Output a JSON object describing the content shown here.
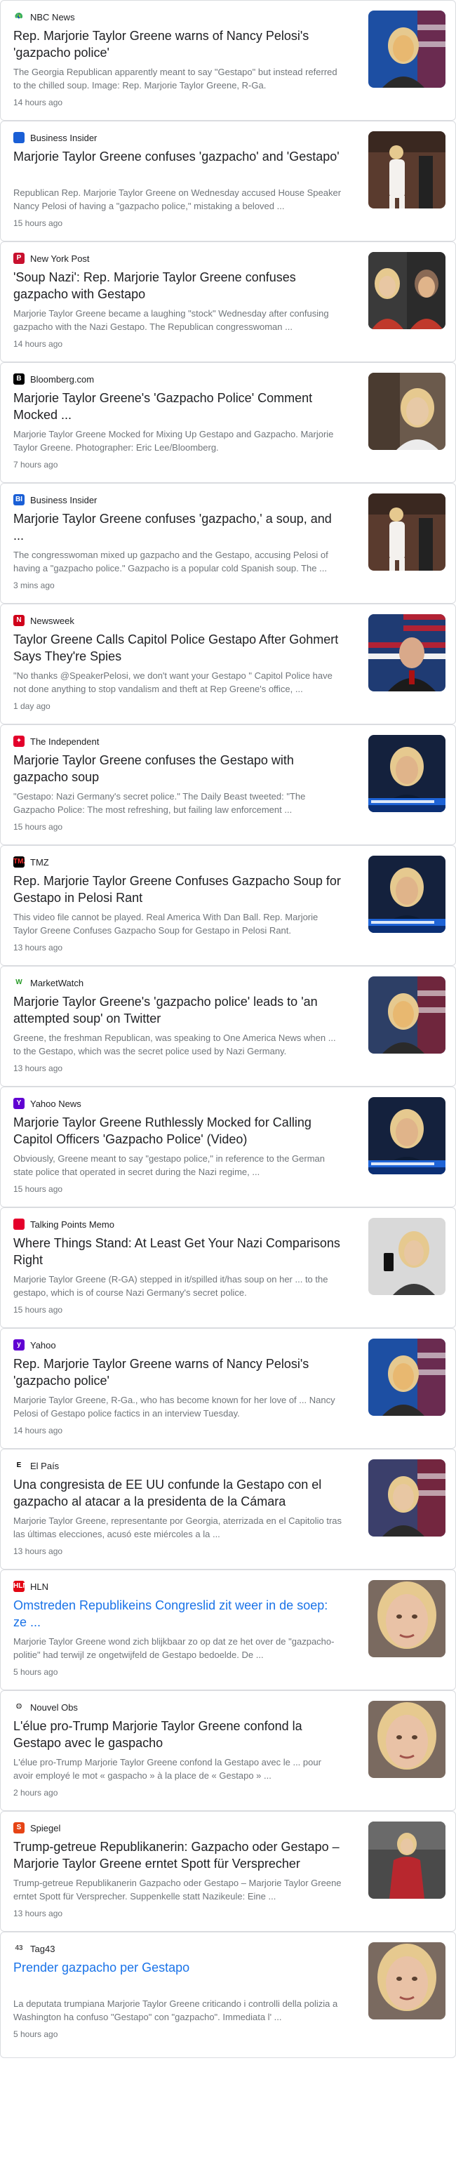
{
  "articles": [
    {
      "source": "NBC News",
      "favicon": {
        "glyph": "🦚",
        "color": "#ffffff",
        "text_color": "#000000"
      },
      "title": "Rep. Marjorie Taylor Greene warns of Nancy Pelosi's 'gazpacho police'",
      "snippet": "The Georgia Republican apparently meant to say \"Gestapo\" but instead referred to the chilled soup. Image: Rep. Marjorie Taylor Greene, R-Ga.",
      "time": "14 hours ago",
      "thumb": {
        "bg": "#1d4fa3",
        "accent": "#e8b870",
        "kind": "portrait-flag"
      }
    },
    {
      "source": "Business Insider",
      "favicon": {
        "glyph": "",
        "color": "#1a5fd6",
        "text_color": "#ffffff"
      },
      "title": "Marjorie Taylor Greene confuses 'gazpacho' and 'Gestapo'",
      "snippet": "Republican Rep. Marjorie Taylor Greene on Wednesday accused House Speaker Nancy Pelosi of having a \"gazpacho police,\" mistaking a beloved ...",
      "time": "15 hours ago",
      "thumb": {
        "bg": "#5a3b2e",
        "accent": "#f4f1ee",
        "kind": "standing"
      }
    },
    {
      "source": "New York Post",
      "favicon": {
        "glyph": "P",
        "color": "#c8102e",
        "text_color": "#ffffff"
      },
      "title": "'Soup Nazi': Rep. Marjorie Taylor Greene confuses gazpacho with Gestapo",
      "snippet": "Marjorie Taylor Greene became a laughing \"stock\" Wednesday after confusing gazpacho with the Nazi Gestapo. The Republican congresswoman ...",
      "time": "14 hours ago",
      "thumb": {
        "bg": "#2b2b2b",
        "accent": "#c0392b",
        "kind": "split"
      }
    },
    {
      "source": "Bloomberg.com",
      "favicon": {
        "glyph": "B",
        "color": "#000000",
        "text_color": "#ffffff"
      },
      "title": "Marjorie Taylor Greene's 'Gazpacho Police' Comment Mocked ...",
      "snippet": "Marjorie Taylor Greene Mocked for Mixing Up Gestapo and Gazpacho. Marjorie Taylor Greene. Photographer: Eric Lee/Bloomberg.",
      "time": "7 hours ago",
      "thumb": {
        "bg": "#6b5a4c",
        "accent": "#e7c9a6",
        "kind": "portrait"
      }
    },
    {
      "source": "Business Insider",
      "favicon": {
        "glyph": "BI",
        "color": "#1a5fd6",
        "text_color": "#ffffff"
      },
      "title": "Marjorie Taylor Greene confuses 'gazpacho,' a soup, and ...",
      "snippet": "The congresswoman mixed up gazpacho and the Gestapo, accusing Pelosi of having a \"gazpacho police.\" Gazpacho is a popular cold Spanish soup. The ...",
      "time": "3 mins ago",
      "thumb": {
        "bg": "#5a3b2e",
        "accent": "#f4f1ee",
        "kind": "standing"
      }
    },
    {
      "source": "Newsweek",
      "favicon": {
        "glyph": "N",
        "color": "#d0021b",
        "text_color": "#ffffff"
      },
      "title": "Taylor Greene Calls Capitol Police Gestapo After Gohmert Says They're Spies",
      "snippet": "\"No thanks @SpeakerPelosi, we don't want your Gestapo \" Capitol Police have not done anything to stop vandalism and theft at Rep Greene's office, ...",
      "time": "1 day ago",
      "thumb": {
        "bg": "#1f3b73",
        "accent": "#b22234",
        "kind": "flag-man"
      }
    },
    {
      "source": "The Independent",
      "favicon": {
        "glyph": "✦",
        "color": "#e3002b",
        "text_color": "#ffffff"
      },
      "title": "Marjorie Taylor Greene confuses the Gestapo with gazpacho soup",
      "snippet": "\"Gestapo: Nazi Germany's secret police.\" The Daily Beast tweeted: \"The Gazpacho Police: The most refreshing, but failing law enforcement ...",
      "time": "15 hours ago",
      "thumb": {
        "bg": "#14213d",
        "accent": "#e0b48a",
        "kind": "tv"
      }
    },
    {
      "source": "TMZ",
      "favicon": {
        "glyph": "TMZ",
        "color": "#000000",
        "text_color": "#ff3030"
      },
      "title": "Rep. Marjorie Taylor Greene Confuses Gazpacho Soup for Gestapo in Pelosi Rant",
      "snippet": "This video file cannot be played. Real America With Dan Ball. Rep. Marjorie Taylor Greene Confuses Gazpacho Soup for Gestapo in Pelosi Rant.",
      "time": "13 hours ago",
      "thumb": {
        "bg": "#14213d",
        "accent": "#e0b48a",
        "kind": "tv"
      }
    },
    {
      "source": "MarketWatch",
      "favicon": {
        "glyph": "W",
        "color": "#ffffff",
        "text_color": "#2a9d2a"
      },
      "title": "Marjorie Taylor Greene's 'gazpacho police' leads to 'an attempted soup' on Twitter",
      "snippet": "Greene, the freshman Republican, was speaking to One America News when ... to the Gestapo, which was the secret police used by Nazi Germany.",
      "time": "13 hours ago",
      "thumb": {
        "bg": "#2d3f66",
        "accent": "#e8b870",
        "kind": "portrait-flag"
      }
    },
    {
      "source": "Yahoo News",
      "favicon": {
        "glyph": "Y",
        "color": "#6001d2",
        "text_color": "#ffffff"
      },
      "title": "Marjorie Taylor Greene Ruthlessly Mocked for Calling Capitol Officers 'Gazpacho Police' (Video)",
      "snippet": "Obviously, Greene meant to say \"gestapo police,\" in reference to the German state police that operated in secret during the Nazi regime, ...",
      "time": "15 hours ago",
      "thumb": {
        "bg": "#14213d",
        "accent": "#e0b48a",
        "kind": "tv"
      }
    },
    {
      "source": "Talking Points Memo",
      "favicon": {
        "glyph": "",
        "color": "#e4002b",
        "text_color": "#ffffff"
      },
      "title": "Where Things Stand: At Least Get Your Nazi Comparisons Right",
      "snippet": "Marjorie Taylor Greene (R-GA) stepped in it/spilled it/has soup on her ... to the gestapo, which is of course Nazi Germany's secret police.",
      "time": "15 hours ago",
      "thumb": {
        "bg": "#d9d9d9",
        "accent": "#e8c7a3",
        "kind": "phone"
      }
    },
    {
      "source": "Yahoo",
      "favicon": {
        "glyph": "y",
        "color": "#6001d2",
        "text_color": "#ffffff"
      },
      "title": "Rep. Marjorie Taylor Greene warns of Nancy Pelosi's 'gazpacho police'",
      "snippet": "Marjorie Taylor Greene, R-Ga., who has become known for her love of ... Nancy Pelosi of Gestapo police factics in an interview Tuesday.",
      "time": "14 hours ago",
      "thumb": {
        "bg": "#1d4fa3",
        "accent": "#e8b870",
        "kind": "portrait-flag"
      }
    },
    {
      "source": "El País",
      "favicon": {
        "glyph": "E",
        "color": "#ffffff",
        "text_color": "#000000"
      },
      "title": "Una congresista de EE UU confunde la Gestapo con el gazpacho al atacar a la presidenta de la Cámara",
      "snippet": "Marjorie Taylor Greene, representante por Georgia, aterrizada en el Capitolio tras las últimas elecciones, acusó este miércoles a la ...",
      "time": "13 hours ago",
      "thumb": {
        "bg": "#3b3f6b",
        "accent": "#e8c7a3",
        "kind": "portrait-flag"
      }
    },
    {
      "source": "HLN",
      "favicon": {
        "glyph": "HLN",
        "color": "#e30613",
        "text_color": "#ffffff"
      },
      "title": "Omstreden Republikeins Congreslid zit weer in de soep: ze ...",
      "snippet": "Marjorie Taylor Greene wond zich blijkbaar zo op dat ze het over de \"gazpacho-politie\" had terwijl ze ongetwijfeld de Gestapo bedoelde. De ...",
      "time": "5 hours ago",
      "thumb": {
        "bg": "#7a6a60",
        "accent": "#e9c2a6",
        "kind": "closeup"
      },
      "title_blue": true
    },
    {
      "source": "Nouvel Obs",
      "favicon": {
        "glyph": "𝕆",
        "color": "#ffffff",
        "text_color": "#000000"
      },
      "title": "L'élue pro-Trump Marjorie Taylor Greene confond la Gestapo avec le gaspacho",
      "snippet": "L'élue pro-Trump Marjorie Taylor Greene confond la Gestapo avec le ... pour avoir employé le mot « gaspacho » à la place de « Gestapo » ...",
      "time": "2 hours ago",
      "thumb": {
        "bg": "#7a6a60",
        "accent": "#e9c2a6",
        "kind": "closeup"
      }
    },
    {
      "source": "Spiegel",
      "favicon": {
        "glyph": "S",
        "color": "#e64415",
        "text_color": "#ffffff"
      },
      "title": "Trump-getreue Republikanerin: Gazpacho oder Gestapo – Marjorie Taylor Greene erntet Spott für Versprecher",
      "snippet": "Trump-getreue Republikanerin Gazpacho oder Gestapo – Marjorie Taylor Greene erntet Spott für Versprecher. Suppenkelle statt Nazikeule: Eine ...",
      "time": "13 hours ago",
      "thumb": {
        "bg": "#4a4a4a",
        "accent": "#b8272e",
        "kind": "standing-red"
      }
    },
    {
      "source": "Tag43",
      "favicon": {
        "glyph": "43",
        "color": "#ffffff",
        "text_color": "#555555"
      },
      "title": "Prender gazpacho per Gestapo",
      "snippet": "La deputata trumpiana Marjorie Taylor Greene criticando i controlli della polizia a Washington ha confuso \"Gestapo\" con \"gazpacho\". Immediata l' ...",
      "time": "5 hours ago",
      "thumb": {
        "bg": "#7a6a60",
        "accent": "#e9c2a6",
        "kind": "closeup"
      },
      "title_blue": true
    }
  ]
}
